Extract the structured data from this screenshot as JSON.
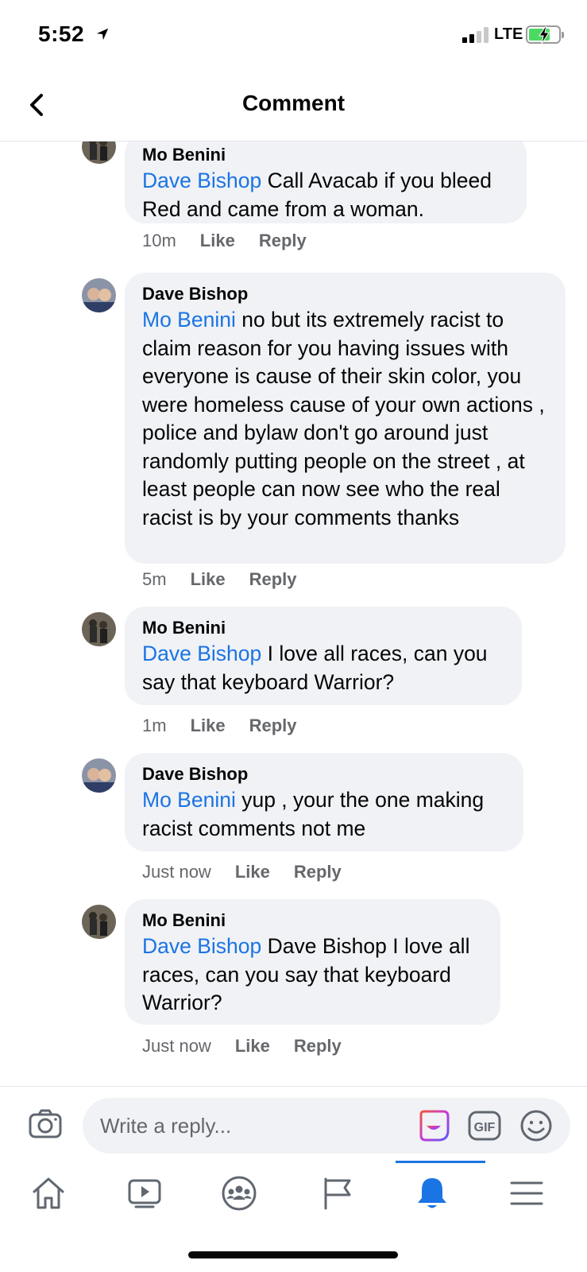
{
  "status_bar": {
    "time": "5:52",
    "network": "LTE",
    "icons": [
      "location-arrow-icon",
      "signal-icon",
      "battery-charging-icon"
    ]
  },
  "header": {
    "title": "Comment",
    "back_icon": "chevron-left-icon"
  },
  "comments": [
    {
      "author": "Mo Benini",
      "mention": "Dave Bishop",
      "text": " Call Avacab if you bleed Red and came from a woman.",
      "time": "10m",
      "like_label": "Like",
      "reply_label": "Reply"
    },
    {
      "author": "Dave Bishop",
      "mention": "Mo Benini",
      "text": " no but its extremely racist to claim reason for you having issues with everyone is cause of their skin color, you were homeless cause of your own actions , police and bylaw don't go around just randomly putting people on the street , at least people can now see who the real racist is by your comments thanks",
      "time": "5m",
      "like_label": "Like",
      "reply_label": "Reply"
    },
    {
      "author": "Mo Benini",
      "mention": "Dave Bishop",
      "text": " I love all races, can you say that keyboard Warrior?",
      "time": "1m",
      "like_label": "Like",
      "reply_label": "Reply"
    },
    {
      "author": "Dave Bishop",
      "mention": "Mo Benini",
      "text": " yup , your the one making racist comments not me",
      "time": "Just now",
      "like_label": "Like",
      "reply_label": "Reply"
    },
    {
      "author": "Mo Benini",
      "mention": "Dave Bishop",
      "text": " Dave Bishop I love all races, can you say that keyboard Warrior?",
      "time": "Just now",
      "like_label": "Like",
      "reply_label": "Reply"
    }
  ],
  "reply_bar": {
    "placeholder": "Write a reply...",
    "icons": [
      "camera-icon",
      "sticker-icon",
      "gif-icon",
      "emoji-icon"
    ]
  },
  "tab_bar": {
    "tabs": [
      "home-icon",
      "watch-icon",
      "groups-icon",
      "pages-icon",
      "notifications-icon",
      "menu-icon"
    ],
    "active_tab": "notifications-icon"
  },
  "colors": {
    "mention": "#1b74e4",
    "bubble": "#f0f2f5",
    "meta_text": "#65676b",
    "active_tab": "#1b74e4"
  }
}
